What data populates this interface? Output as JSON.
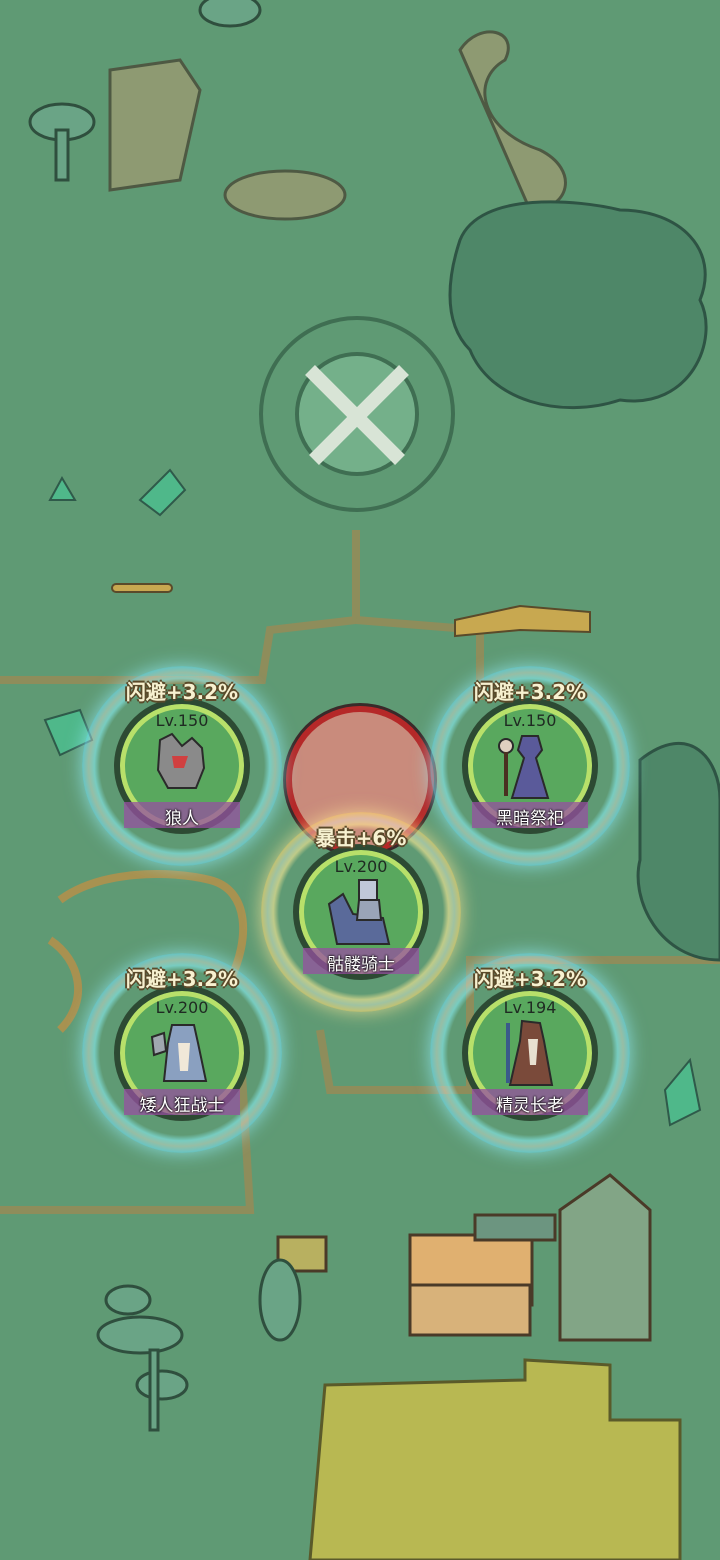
{
  "colors": {
    "background": "#5f9a74",
    "disc_fill": "#59a85e",
    "empty_slot_border": "#b52828"
  },
  "empty_slot": {
    "icon": "empty-slot-icon"
  },
  "units": [
    {
      "bonus": "闪避+3.2%",
      "level": "Lv.150",
      "name": "狼人",
      "icon": "werewolf-icon",
      "ring": "cyan"
    },
    {
      "bonus": "闪避+3.2%",
      "level": "Lv.150",
      "name": "黑暗祭祀",
      "icon": "dark-priest-icon",
      "ring": "cyan"
    },
    {
      "bonus": "暴击+6%",
      "level": "Lv.200",
      "name": "骷髅骑士",
      "icon": "skeleton-knight-icon",
      "ring": "gold"
    },
    {
      "bonus": "闪避+3.2%",
      "level": "Lv.200",
      "name": "矮人狂战士",
      "icon": "dwarf-berserker-icon",
      "ring": "cyan"
    },
    {
      "bonus": "闪避+3.2%",
      "level": "Lv.194",
      "name": "精灵长老",
      "icon": "elf-elder-icon",
      "ring": "cyan"
    }
  ]
}
